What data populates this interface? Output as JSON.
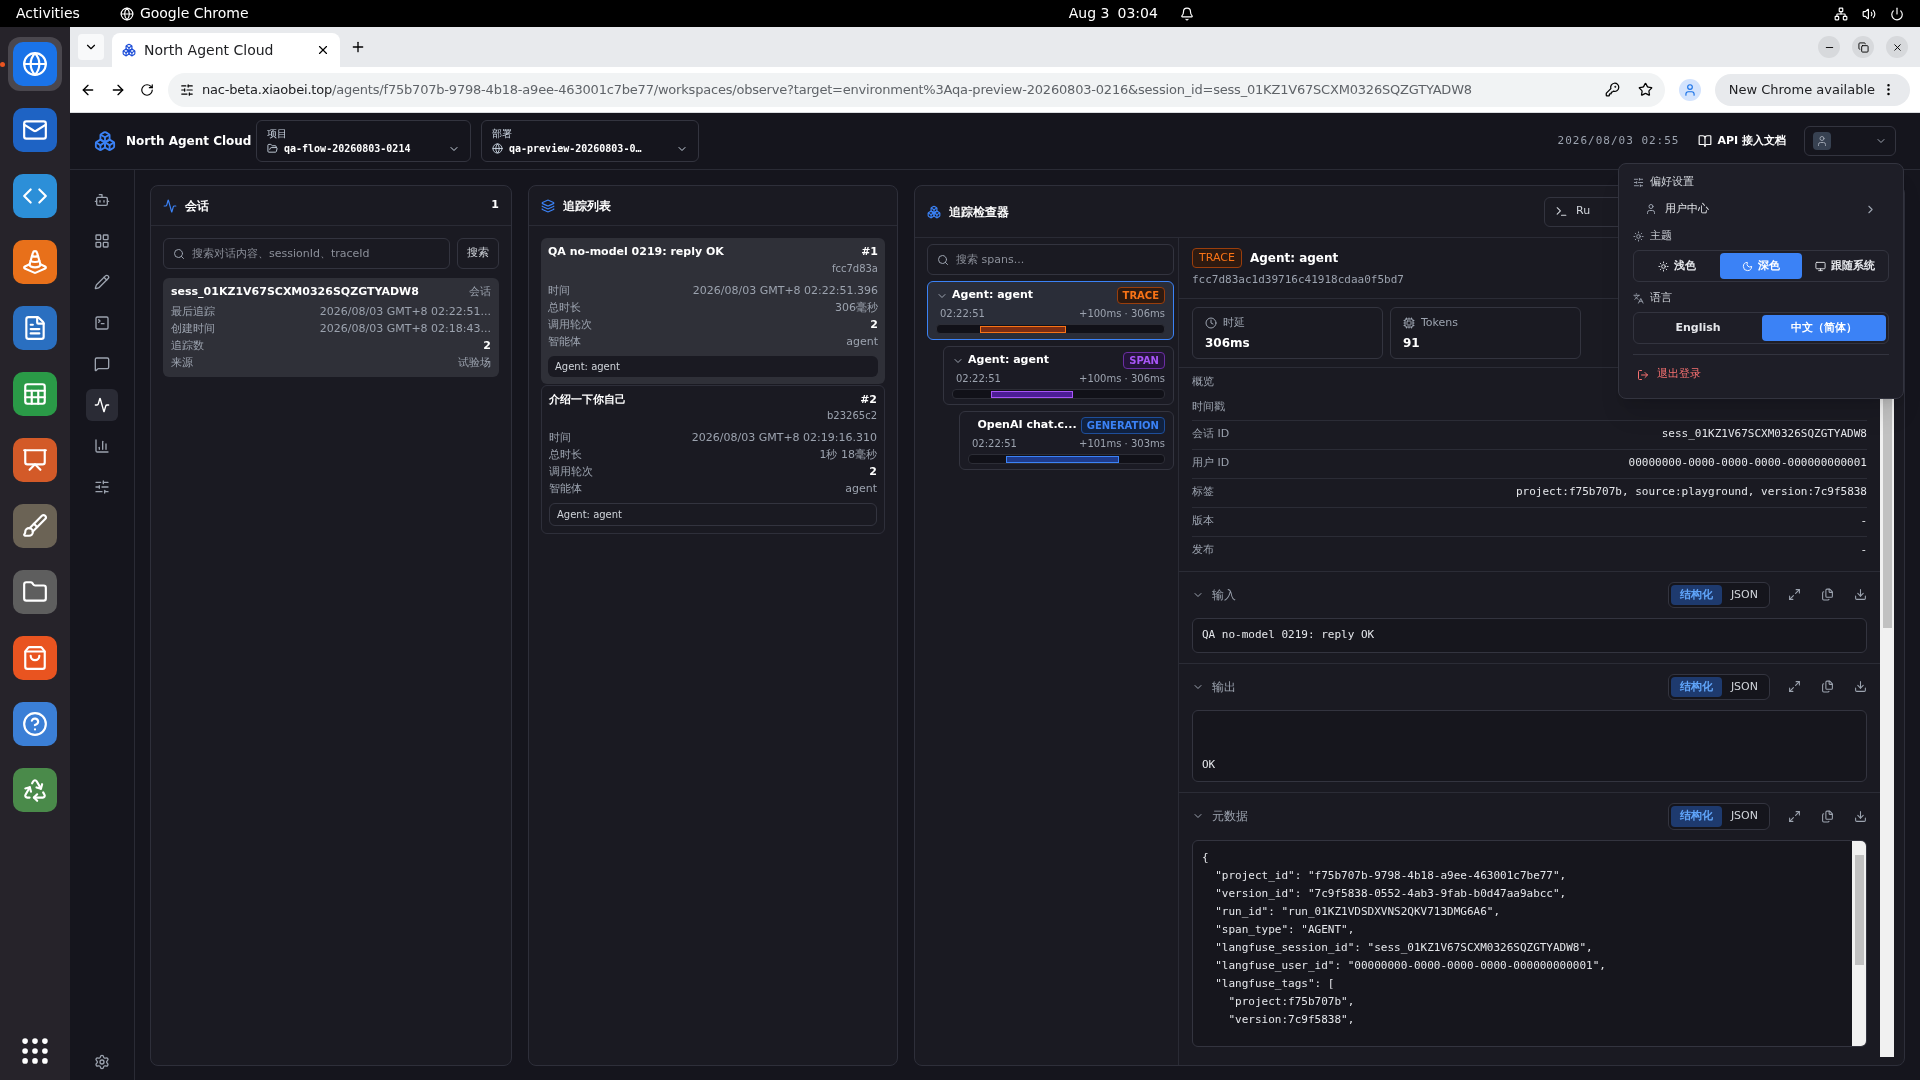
{
  "system_bar": {
    "activities": "Activities",
    "app": "Google Chrome",
    "date": "Aug 3",
    "time": "03:04"
  },
  "browser": {
    "tab_title": "North Agent Cloud",
    "url_host": "nac-beta.xiaobei.top",
    "url_path": "/agents/f75b707b-9798-4b18-a9ee-463001c7be77/workspaces/observe?target=environment%3Aqa-preview-20260803-0216&session_id=sess_01KZ1V67SCXM0326SQZGTYADW8",
    "update": "New Chrome available"
  },
  "dock": [
    {
      "running": true
    },
    {
      "running": false
    },
    {
      "running": false
    },
    {
      "running": false
    },
    {
      "running": false
    },
    {
      "running": false
    },
    {
      "running": false
    },
    {
      "running": false
    },
    {
      "running": false
    },
    {
      "running": false
    },
    {
      "running": false
    },
    {
      "running": false
    }
  ],
  "header": {
    "brand": "North Agent Cloud",
    "project": {
      "label": "项目",
      "value": "qa-flow-20260803-0214"
    },
    "deployment": {
      "label": "部署",
      "value": "qa-preview-20260803-0…"
    },
    "timestamp": "2026/08/03 02:55",
    "docs": "API 接入文档"
  },
  "rail": [
    {
      "selected": false
    },
    {
      "selected": false
    },
    {
      "selected": false
    },
    {
      "selected": false
    },
    {
      "selected": false
    },
    {
      "selected": true
    },
    {
      "selected": false
    },
    {
      "selected": false
    }
  ],
  "sessions": {
    "title": "会话",
    "count": "1",
    "search": {
      "placeholder": "搜索对话内容、sessionId、traceId",
      "button": "搜索"
    },
    "items": [
      {
        "id": "sess_01KZ1V67SCXM0326SQZGTYADW8",
        "tag": "会话",
        "selected": true,
        "fields": [
          {
            "label": "最后追踪",
            "value": "2026/08/03 GMT+8 02:22:51...",
            "emphasis": false
          },
          {
            "label": "创建时间",
            "value": "2026/08/03 GMT+8 02:18:43...",
            "emphasis": false
          },
          {
            "label": "追踪数",
            "value": "2",
            "emphasis": true
          },
          {
            "label": "来源",
            "value": "试验场",
            "emphasis": false
          }
        ]
      }
    ]
  },
  "traces": {
    "title": "追踪列表",
    "items": [
      {
        "title": "QA no-model 0219: reply OK",
        "index": "#1",
        "id": "fcc7d83a",
        "selected": true,
        "agent": "Agent: agent",
        "fields": [
          {
            "label": "时间",
            "value": "2026/08/03 GMT+8 02:22:51.396",
            "emphasis": false
          },
          {
            "label": "总时长",
            "value": "306毫秒",
            "emphasis": false
          },
          {
            "label": "调用轮次",
            "value": "2",
            "emphasis": true
          },
          {
            "label": "智能体",
            "value": "agent",
            "emphasis": false
          }
        ]
      },
      {
        "title": "介绍一下你自己",
        "index": "#2",
        "id": "b23265c2",
        "selected": false,
        "agent": "Agent: agent",
        "fields": [
          {
            "label": "时间",
            "value": "2026/08/03 GMT+8 02:19:16.310",
            "emphasis": false
          },
          {
            "label": "总时长",
            "value": "1秒 18毫秒",
            "emphasis": false
          },
          {
            "label": "调用轮次",
            "value": "2",
            "emphasis": true
          },
          {
            "label": "智能体",
            "value": "agent",
            "emphasis": false
          }
        ]
      }
    ]
  },
  "inspector": {
    "title": "追踪检查器",
    "run_button": "Ru",
    "span_search": {
      "placeholder": "搜索 spans..."
    },
    "spans": [
      {
        "name": "Agent: agent",
        "badge": "TRACE",
        "kind": "trace",
        "time": "02:22:51",
        "timing": "+100ms · 306ms",
        "selected": true,
        "expanded": true,
        "children": [
          {
            "name": "Agent: agent",
            "badge": "SPAN",
            "kind": "span",
            "time": "02:22:51",
            "timing": "+100ms · 306ms",
            "selected": false,
            "expanded": true,
            "children": [
              {
                "name": "OpenAI chat.c...",
                "badge": "GENERATION",
                "kind": "generation",
                "time": "02:22:51",
                "timing": "+101ms · 303ms",
                "selected": false
              }
            ]
          }
        ]
      }
    ],
    "detail": {
      "badge": "TRACE",
      "name": "Agent: agent",
      "id": "fcc7d83ac1d39716c41918cdaa0f5bd7",
      "metrics": [
        {
          "kind": "latency",
          "label": "时延",
          "value": "306ms"
        },
        {
          "kind": "tokens",
          "label": "Tokens",
          "value": "91"
        }
      ],
      "rows": [
        {
          "label": "概览"
        },
        {
          "label": "时间戳"
        },
        {
          "label": "会话 ID",
          "value": "sess_01KZ1V67SCXM0326SQZGTYADW8"
        },
        {
          "label": "用户 ID",
          "value": "00000000-0000-0000-0000-000000000001"
        },
        {
          "label": "标签",
          "value": "project:f75b707b, source:playground, version:7c9f5838"
        },
        {
          "label": "版本",
          "value": "-"
        },
        {
          "label": "发布",
          "value": "-"
        }
      ],
      "sections": [
        {
          "title": "输入",
          "expanded": true,
          "views": [
            {
              "label": "结构化",
              "selected": true
            },
            {
              "label": "JSON",
              "selected": false
            }
          ],
          "lines": [
            "QA no-model 0219: reply OK"
          ],
          "kind": "text"
        },
        {
          "title": "输出",
          "expanded": true,
          "views": [
            {
              "label": "结构化",
              "selected": true
            },
            {
              "label": "JSON",
              "selected": false
            }
          ],
          "lines": [
            "OK"
          ],
          "kind": "padded"
        },
        {
          "title": "元数据",
          "expanded": true,
          "views": [
            {
              "label": "结构化",
              "selected": true
            },
            {
              "label": "JSON",
              "selected": false
            }
          ],
          "kind": "code",
          "lines": [
            "{",
            "  \"project_id\": \"f75b707b-9798-4b18-a9ee-463001c7be77\",",
            "  \"version_id\": \"7c9f5838-0552-4ab3-9fab-b0d47aa9abcc\",",
            "  \"run_id\": \"run_01KZ1VDSDXVNS2QKV713DMG6A6\",",
            "  \"span_type\": \"AGENT\",",
            "  \"langfuse_session_id\": \"sess_01KZ1V67SCXM0326SQZGTYADW8\",",
            "  \"langfuse_user_id\": \"00000000-0000-0000-0000-000000000001\",",
            "  \"langfuse_tags\": [",
            "    \"project:f75b707b\",",
            "    \"version:7c9f5838\","
          ]
        }
      ]
    }
  },
  "menu": {
    "preferences": "偏好设置",
    "user_center": "用户中心",
    "theme": {
      "label": "主题",
      "options": [
        {
          "kind": "light",
          "label": "浅色",
          "selected": false
        },
        {
          "kind": "dark",
          "label": "深色",
          "selected": true
        },
        {
          "kind": "system",
          "label": "跟随系统",
          "selected": false
        }
      ]
    },
    "language": {
      "label": "语言",
      "options": [
        {
          "label": "English",
          "selected": false
        },
        {
          "label": "中文（简体）",
          "selected": true
        }
      ]
    },
    "logout": "退出登录"
  }
}
